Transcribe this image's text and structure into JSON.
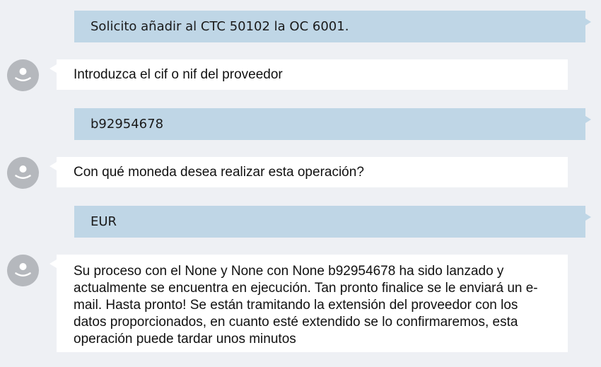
{
  "conversation": {
    "messages": [
      {
        "sender": "user",
        "text": "Solicito añadir al CTC 50102 la OC 6001."
      },
      {
        "sender": "bot",
        "text": "Introduzca el cif o nif del proveedor"
      },
      {
        "sender": "user",
        "text": "b92954678"
      },
      {
        "sender": "bot",
        "text": "Con qué moneda desea realizar esta operación?"
      },
      {
        "sender": "user",
        "text": "EUR"
      },
      {
        "sender": "bot",
        "lines": [
          "Su proceso con el None y None con None b92954678 ha sido lanzado y",
          "actualmente se encuentra en ejecución. Tan pronto finalice se le enviará un e-",
          "mail. Hasta pronto! Se están tramitando la extensión del proveedor con los",
          "datos proporcionados, en cuanto esté extendido se lo confirmaremos, esta",
          "operación puede tardar unos minutos"
        ]
      }
    ]
  },
  "colors": {
    "background": "#eef0f4",
    "user_bubble": "#bfd6e6",
    "bot_bubble": "#ffffff",
    "avatar": "#b5b8bd"
  },
  "icons": {
    "bot_avatar": "user-avatar-icon"
  }
}
